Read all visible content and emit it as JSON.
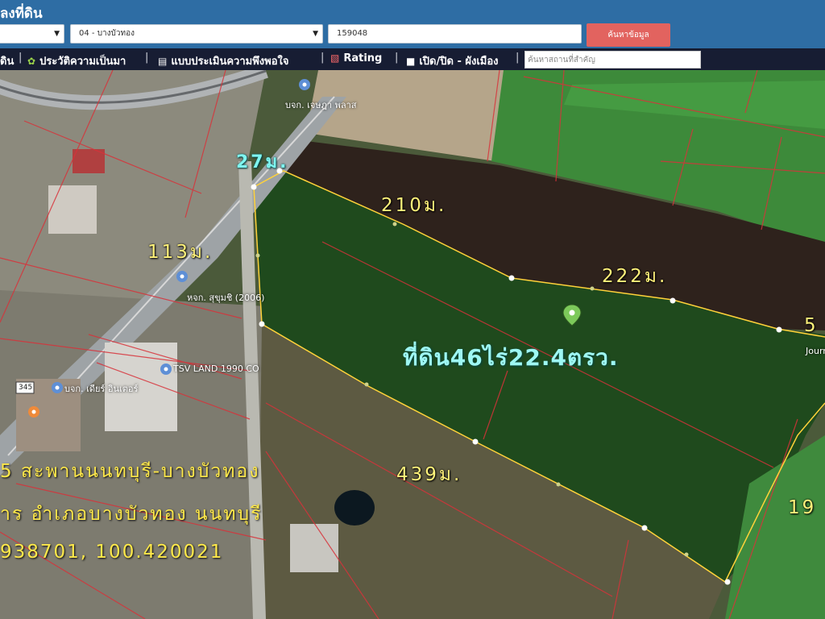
{
  "header": {
    "title": "ลงที่ดิน",
    "district_select": "04 - บางบัวทอง",
    "parcel_input": "159048",
    "search_button": "ค้นหาข้อมูล"
  },
  "toolbar": {
    "item_0": "ดิน",
    "item_1": "ประวัติความเป็นมา",
    "item_2": "แบบประเมินความพึงพอใจ",
    "item_3": "Rating",
    "item_4": "เปิด/ปิด - ผังเมือง",
    "place_search_placeholder": "ค้นหาสถานที่สำคัญ"
  },
  "map": {
    "dim_27": "27ม.",
    "dim_210": "210ม.",
    "dim_113": "113ม.",
    "dim_222": "222ม.",
    "dim_5": "5",
    "dim_439": "439ม.",
    "dim_19": "19",
    "area_label": "ที่ดิน46ไร่22.4ตรว.",
    "addr_line1": "5 สะพานนนทบุรี-บางบัวทอง",
    "addr_line2": "าร อำเภอบางบัวทอง นนทบุรี",
    "coords": "938701, 100.420021",
    "poi_1": "บจก. เจษฎา พลาส",
    "poi_2": "หจก. สุขุมชิ (2006)",
    "poi_3": "TSV LAND 1990 CO",
    "poi_4": "Journey",
    "poi_5": "บจก. เดียร์ อินเตอร์",
    "road_badge": "345"
  }
}
